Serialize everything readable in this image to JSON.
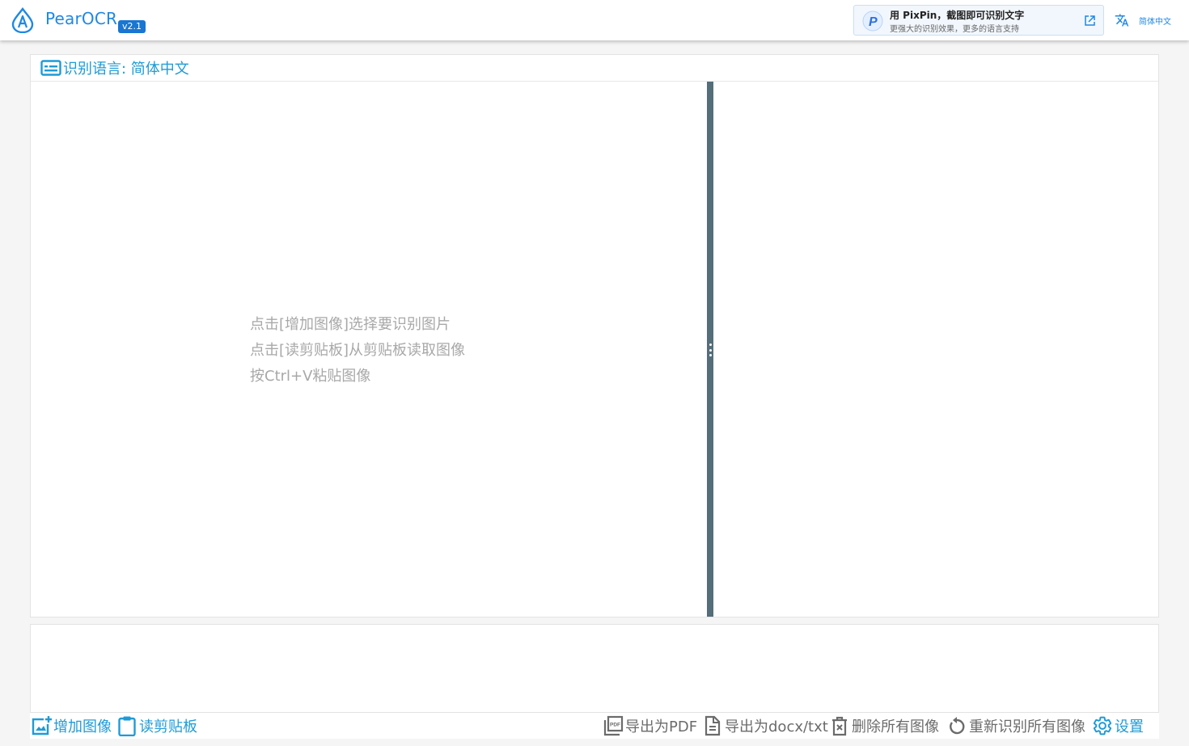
{
  "header": {
    "app_name": "PearOCR",
    "version": "v2.1",
    "promo": {
      "title": "用 PixPin，截图即可识别文字",
      "subtitle": "更强大的识别效果，更多的语言支持"
    },
    "language": "简体中文"
  },
  "main": {
    "language_bar": "识别语言: 简体中文",
    "hints": [
      "点击[增加图像]选择要识别图片",
      "点击[读剪贴板]从剪贴板读取图像",
      "按Ctrl+V粘贴图像"
    ]
  },
  "toolbar": {
    "add_image": "增加图像",
    "read_clipboard": "读剪贴板",
    "export_pdf": "导出为PDF",
    "export_docx": "导出为docx/txt",
    "delete_all": "删除所有图像",
    "reocr_all": "重新识别所有图像",
    "settings": "设置"
  },
  "colors": {
    "accent": "#1e9bd7",
    "brand": "#1e88e5",
    "splitter": "#546e7a",
    "hint_text": "#a8a8a8",
    "disabled_text": "#6b6b6b"
  },
  "icons": {
    "logo": "pear-logo-icon",
    "promo": "pixpin-icon",
    "external": "external-link-icon",
    "translate": "translate-icon",
    "language": "subtitles-icon",
    "add_image": "add-photo-icon",
    "clipboard": "clipboard-icon",
    "pdf": "pdf-icon",
    "document": "document-icon",
    "delete": "delete-icon",
    "refresh": "refresh-icon",
    "settings": "gear-icon"
  }
}
